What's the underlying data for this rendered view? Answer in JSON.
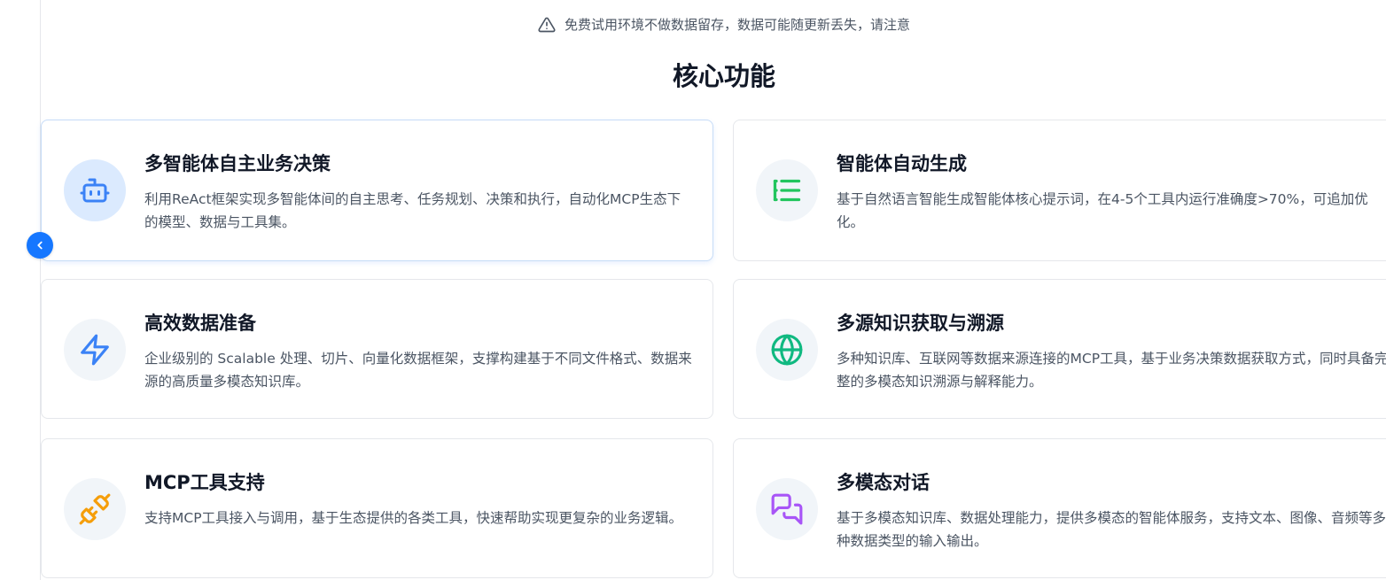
{
  "notice": {
    "icon": "warning-triangle-icon",
    "text": "免费试用环境不做数据留存，数据可能随更新丢失，请注意"
  },
  "section": {
    "title": "核心功能"
  },
  "nav": {
    "prev_icon": "chevron-left-icon",
    "accent_color": "#1677ff"
  },
  "features": [
    {
      "title": "多智能体自主业务决策",
      "description": "利用ReAct框架实现多智能体间的自主思考、任务规划、决策和执行，自动化MCP生态下的模型、数据与工具集。",
      "icon": "robot-icon",
      "icon_color": "#3b82f6"
    },
    {
      "title": "智能体自动生成",
      "description": "基于自然语言智能生成智能体核心提示词，在4-5个工具内运行准确度>70%，可追加优化。",
      "icon": "list-icon",
      "icon_color": "#22c55e"
    },
    {
      "title": "高效数据准备",
      "description": "企业级别的 Scalable 处理、切片、向量化数据框架，支撑构建基于不同文件格式、数据来源的高质量多模态知识库。",
      "icon": "lightning-icon",
      "icon_color": "#3b82f6"
    },
    {
      "title": "多源知识获取与溯源",
      "description": "多种知识库、互联网等数据来源连接的MCP工具，基于业务决策数据获取方式，同时具备完整的多模态知识溯源与解释能力。",
      "icon": "globe-icon",
      "icon_color": "#10b981"
    },
    {
      "title": "MCP工具支持",
      "description": "支持MCP工具接入与调用，基于生态提供的各类工具，快速帮助实现更复杂的业务逻辑。",
      "icon": "plug-icon",
      "icon_color": "#f59e0b"
    },
    {
      "title": "多模态对话",
      "description": "基于多模态知识库、数据处理能力，提供多模态的智能体服务，支持文本、图像、音频等多种数据类型的输入输出。",
      "icon": "chat-bubbles-icon",
      "icon_color": "#a855f7"
    }
  ]
}
